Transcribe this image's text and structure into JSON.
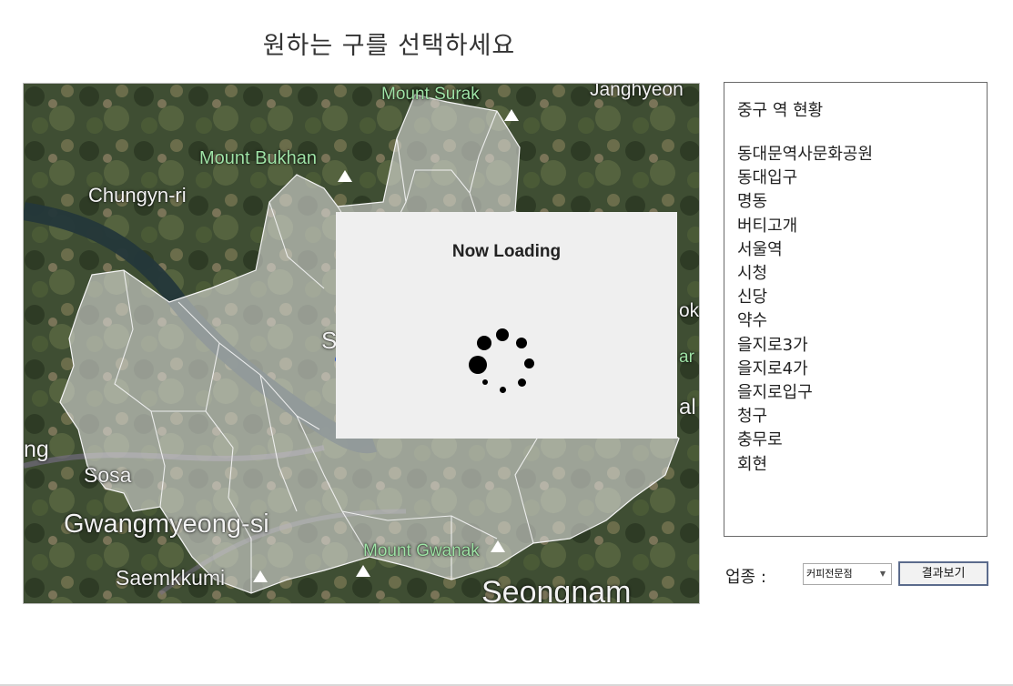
{
  "page": {
    "title": "원하는 구를 선택하세요"
  },
  "map": {
    "labels": {
      "mount_surak": "Mount Surak",
      "janghyeon": "Janghyeon",
      "mount_bukhan": "Mount Bukhan",
      "chungyn_ri": "Chungyn-ri",
      "gimpo_partial": "ng",
      "sosa": "Sosa",
      "gwangmyeong": "Gwangmyeong-si",
      "mount_gwanak": "Mount Gwanak",
      "saemkkumi": "Saemkkumi",
      "seongnam": "Seongnam",
      "seoul_partial": "S",
      "right_partial_1": "ok",
      "right_partial_2": "ar",
      "right_partial_3": "al"
    }
  },
  "loading": {
    "text": "Now Loading"
  },
  "station_panel": {
    "title": "중구 역 현황",
    "stations": [
      "동대문역사문화공원",
      "동대입구",
      "명동",
      "버티고개",
      "서울역",
      "시청",
      "신당",
      "약수",
      "을지로3가",
      "을지로4가",
      "을지로입구",
      "청구",
      "충무로",
      "회현"
    ]
  },
  "controls": {
    "industry_label": "업종 :",
    "industry_selected": "커피전문점",
    "result_button": "결과보기"
  },
  "colors": {
    "accent_border": "#5b6b8c",
    "loading_bg": "#efefef"
  }
}
